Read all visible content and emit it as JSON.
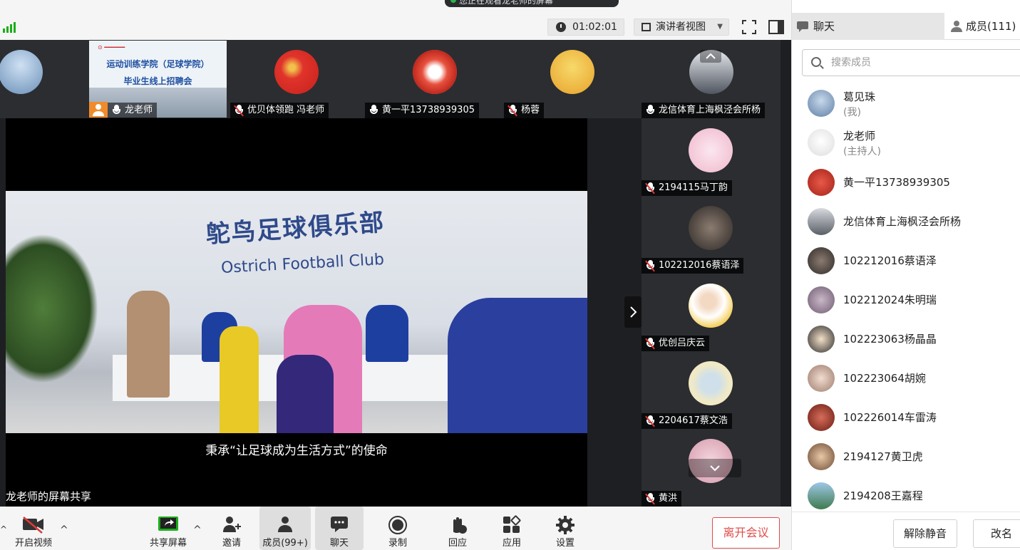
{
  "notice": "您正在观看龙老师的屏幕",
  "topbar": {
    "timer": "01:02:01",
    "view_mode": "演讲者视图"
  },
  "sidebar": {
    "tab_chat": "聊天",
    "tab_members": "成员(111)",
    "search_placeholder": "搜索成员",
    "members": [
      {
        "name": "葛见珠",
        "role": "(我)"
      },
      {
        "name": "龙老师",
        "role": "(主持人)"
      },
      {
        "name": "黄一平13738939305",
        "role": ""
      },
      {
        "name": "龙信体育上海枫泾会所杨",
        "role": ""
      },
      {
        "name": "102212016蔡语泽",
        "role": ""
      },
      {
        "name": "102212024朱明瑞",
        "role": ""
      },
      {
        "name": "102223063杨晶晶",
        "role": ""
      },
      {
        "name": "102223064胡婉",
        "role": ""
      },
      {
        "name": "102226014车雷涛",
        "role": ""
      },
      {
        "name": "2194127黄卫虎",
        "role": ""
      },
      {
        "name": "2194208王嘉程",
        "role": ""
      }
    ],
    "unmute_all": "解除静音",
    "rename": "改名"
  },
  "participants_top": [
    {
      "name": "龙老师"
    },
    {
      "name": "优贝体领跑 冯老师"
    },
    {
      "name": "黄一平13738939305"
    },
    {
      "name": "杨蓉"
    },
    {
      "name": "龙信体育上海枫泾会所杨"
    }
  ],
  "participants_right": [
    {
      "name": "2194115马丁韵"
    },
    {
      "name": "102212016蔡语泽"
    },
    {
      "name": "优创吕庆云"
    },
    {
      "name": "2204617蔡文浩"
    },
    {
      "name": "黄洪"
    }
  ],
  "banner": {
    "line1": "运动训练学院（足球学院）",
    "line2": "毕业生线上招聘会"
  },
  "share": {
    "sign_cn": "鸵鸟足球俱乐部",
    "sign_en": "Ostrich Football Club",
    "subtitle": "秉承“让足球成为生活方式”的使命",
    "label": "龙老师的屏幕共享"
  },
  "toolbar": {
    "video": "开启视频",
    "share": "共享屏幕",
    "invite": "邀请",
    "members": "成员(99+)",
    "chat": "聊天",
    "record": "录制",
    "react": "回应",
    "apps": "应用",
    "settings": "设置",
    "leave": "离开会议"
  }
}
